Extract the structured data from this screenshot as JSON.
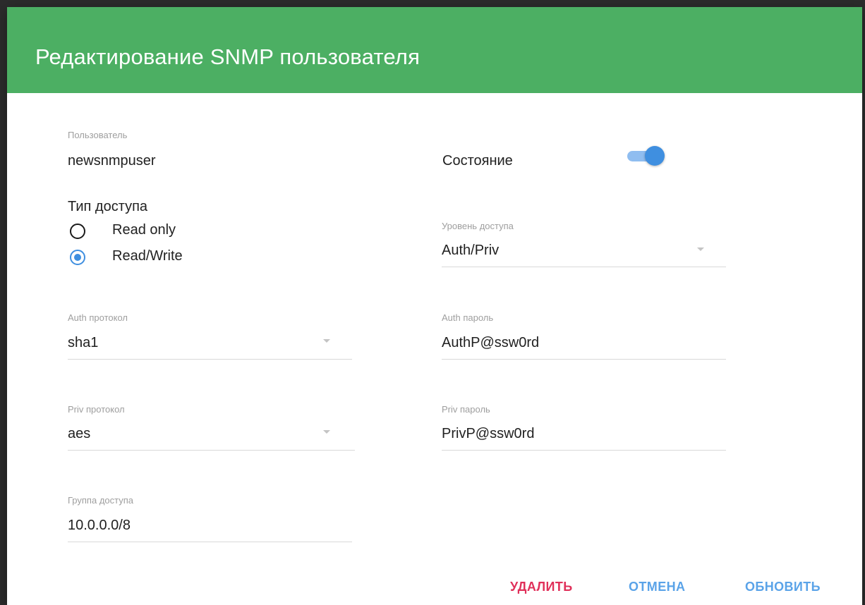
{
  "dialog": {
    "title": "Редактирование SNMP пользователя",
    "header_color": "#4caf63",
    "accent_color": "#3f8fe0",
    "danger_color": "#e0305a"
  },
  "user": {
    "label": "Пользователь",
    "value": "newsnmpuser"
  },
  "state": {
    "label": "Состояние",
    "enabled": true
  },
  "access_type": {
    "label": "Тип доступа",
    "options": [
      {
        "label": "Read only",
        "selected": false
      },
      {
        "label": "Read/Write",
        "selected": true
      }
    ]
  },
  "access_level": {
    "label": "Уровень доступа",
    "value": "Auth/Priv"
  },
  "auth_protocol": {
    "label": "Auth протокол",
    "value": "sha1"
  },
  "auth_password": {
    "label": "Auth пароль",
    "value": "AuthP@ssw0rd"
  },
  "priv_protocol": {
    "label": "Priv протокол",
    "value": "aes"
  },
  "priv_password": {
    "label": "Priv пароль",
    "value": "PrivP@ssw0rd"
  },
  "access_group": {
    "label": "Группа доступа",
    "value": "10.0.0.0/8"
  },
  "actions": {
    "delete": "УДАЛИТЬ",
    "cancel": "ОТМЕНА",
    "update": "ОБНОВИТЬ"
  }
}
